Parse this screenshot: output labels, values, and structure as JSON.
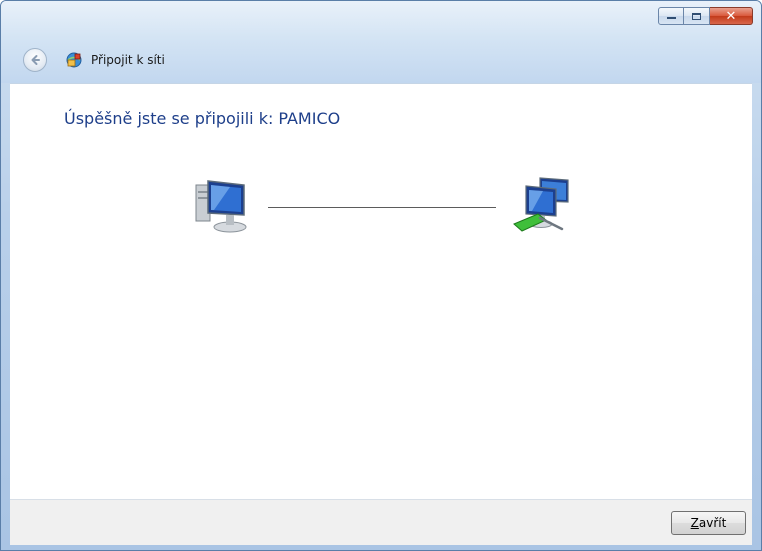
{
  "window": {
    "title": "Připojit k síti",
    "caption_buttons": [
      "minimize",
      "maximize",
      "close"
    ]
  },
  "main": {
    "heading": "Úspěšně jste se připojili k:",
    "network_name": "PAMICO",
    "icons": {
      "local": "computer-icon",
      "remote": "network-icon"
    }
  },
  "footer": {
    "close_button": {
      "mnemonic": "Z",
      "rest": "avřít"
    }
  },
  "colors": {
    "heading": "#1e3f8a",
    "titlebar": "#d4e4f4",
    "close_caption": "#c23a1a"
  }
}
